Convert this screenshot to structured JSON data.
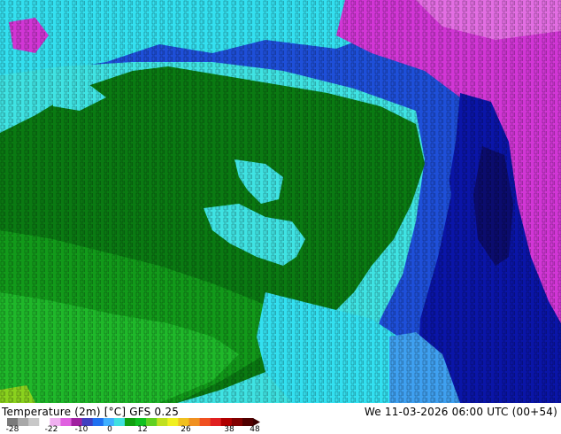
{
  "map": {
    "colors": {
      "deep_blue": "#0a15a8",
      "blue": "#1e4fd8",
      "light_blue": "#3fa0f0",
      "cyan": "#33e0f0",
      "aqua": "#3fe3e3",
      "dark_green": "#0a7a12",
      "green": "#129a1a",
      "light_green": "#1fb82a",
      "magenta": "#d236d6",
      "pink": "#e36ee3",
      "yellow_green": "#8ad21e",
      "dark_navy": "#0b0c6e"
    }
  },
  "footer": {
    "title": "Temperature (2m) [°C] GFS 0.25",
    "datetime": "We 11-03-2026 06:00 UTC (00+54)"
  },
  "colorbar": {
    "ticks": [
      "-28",
      "-22",
      "-10",
      "0",
      "12",
      "26",
      "38",
      "48"
    ],
    "colors": [
      "#7a7a7a",
      "#a8a8a8",
      "#c8c8c8",
      "#ffffff",
      "#f0b0f0",
      "#e060e0",
      "#a020a0",
      "#4040c0",
      "#2070f0",
      "#40b0ff",
      "#40e0e0",
      "#10a010",
      "#10c020",
      "#60d020",
      "#c0e020",
      "#f0f020",
      "#f0c020",
      "#f09020",
      "#f05020",
      "#e02020",
      "#b00000",
      "#800000",
      "#500000"
    ]
  }
}
